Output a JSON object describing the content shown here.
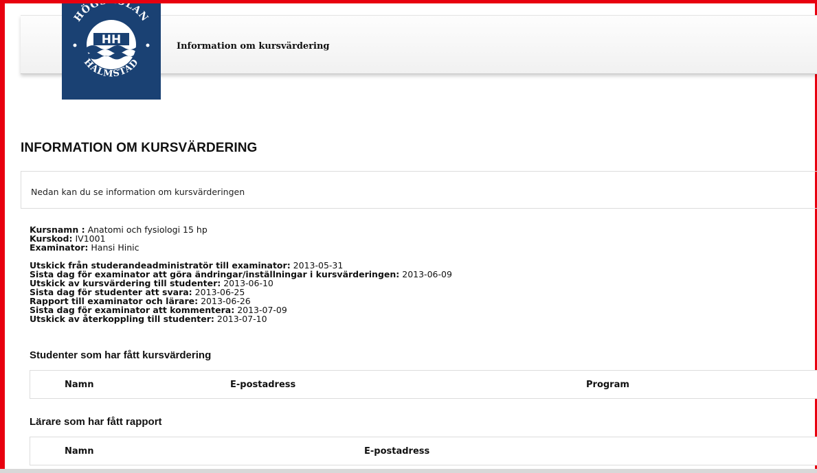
{
  "colors": {
    "frame": "#e8000f",
    "logo_bg": "#1a4173"
  },
  "logo": {
    "icon": "hogskolan-halmstad-seal-icon",
    "top_text": "HÖGSKOLAN",
    "bottom_text": "HALMSTAD",
    "center_text": "HH"
  },
  "header": {
    "title": "Information om kursvärdering"
  },
  "page": {
    "heading": "INFORMATION OM KURSVÄRDERING",
    "intro": "Nedan kan du se information om kursvärderingen"
  },
  "course": [
    {
      "label": "Kursnamn :",
      "value": "Anatomi och fysiologi 15 hp"
    },
    {
      "label": "Kurskod:",
      "value": "IV1001"
    },
    {
      "label": "Examinator:",
      "value": "Hansi Hinic"
    }
  ],
  "schedule": [
    {
      "label": "Utskick från studerandeadministratör till examinator:",
      "value": "2013-05-31"
    },
    {
      "label": "Sista dag för examinator att göra ändringar/inställningar i kursvärderingen:",
      "value": "2013-06-09"
    },
    {
      "label": "Utskick av kursvärdering till studenter:",
      "value": "2013-06-10"
    },
    {
      "label": "Sista dag för studenter att svara:",
      "value": "2013-06-25"
    },
    {
      "label": "Rapport till examinator och lärare:",
      "value": "2013-06-26"
    },
    {
      "label": "Sista dag för examinator att kommentera:",
      "value": "2013-07-09"
    },
    {
      "label": "Utskick av återkoppling till studenter:",
      "value": "2013-07-10"
    }
  ],
  "students_section": {
    "title": "Studenter som har fått kursvärdering",
    "columns": [
      "Namn",
      "E-postadress",
      "Program"
    ]
  },
  "teachers_section": {
    "title": "Lärare som har fått rapport",
    "columns": [
      "Namn",
      "E-postadress"
    ]
  }
}
